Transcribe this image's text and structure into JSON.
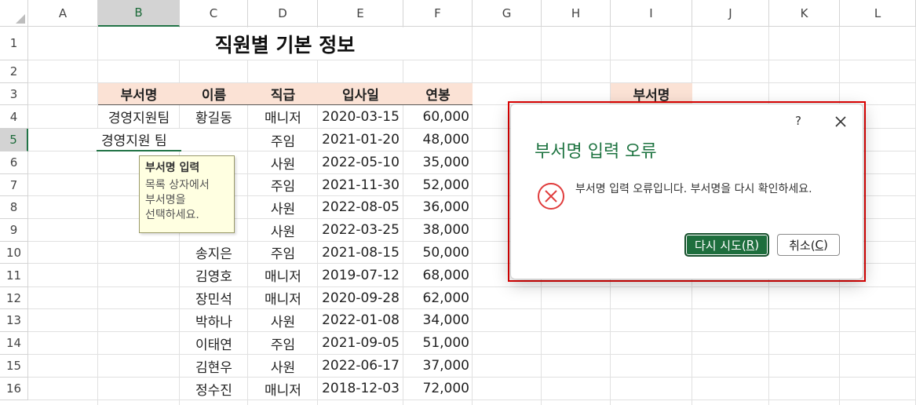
{
  "columns": [
    "A",
    "B",
    "C",
    "D",
    "E",
    "F",
    "G",
    "H",
    "I",
    "J",
    "K",
    "L"
  ],
  "selected_column": "B",
  "rows": [
    "1",
    "2",
    "3",
    "4",
    "5",
    "6",
    "7",
    "8",
    "9",
    "10",
    "11",
    "12",
    "13",
    "14",
    "15",
    "16"
  ],
  "selected_row": "5",
  "sheet_title": "직원별 기본 정보",
  "table_headers": [
    "부서명",
    "이름",
    "직급",
    "입사일",
    "연봉"
  ],
  "side_header": "부서명",
  "data_rows": [
    {
      "dept": "경영지원팀",
      "name": "황길동",
      "rank": "매니저",
      "date": "2020-03-15",
      "salary": "60,000"
    },
    {
      "dept": "",
      "name": "",
      "rank": "주임",
      "date": "2021-01-20",
      "salary": "48,000"
    },
    {
      "dept": "",
      "name": "",
      "rank": "사원",
      "date": "2022-05-10",
      "salary": "35,000"
    },
    {
      "dept": "",
      "name": "",
      "rank": "주임",
      "date": "2021-11-30",
      "salary": "52,000"
    },
    {
      "dept": "",
      "name": "",
      "rank": "사원",
      "date": "2022-08-05",
      "salary": "36,000"
    },
    {
      "dept": "",
      "name": "",
      "rank": "사원",
      "date": "2022-03-25",
      "salary": "38,000"
    },
    {
      "dept": "",
      "name": "송지은",
      "rank": "주임",
      "date": "2021-08-15",
      "salary": "50,000"
    },
    {
      "dept": "",
      "name": "김영호",
      "rank": "매니저",
      "date": "2019-07-12",
      "salary": "68,000"
    },
    {
      "dept": "",
      "name": "장민석",
      "rank": "매니저",
      "date": "2020-09-28",
      "salary": "62,000"
    },
    {
      "dept": "",
      "name": "박하나",
      "rank": "사원",
      "date": "2022-01-08",
      "salary": "34,000"
    },
    {
      "dept": "",
      "name": "이태연",
      "rank": "주임",
      "date": "2021-09-05",
      "salary": "51,000"
    },
    {
      "dept": "",
      "name": "김현우",
      "rank": "사원",
      "date": "2022-06-17",
      "salary": "37,000"
    },
    {
      "dept": "",
      "name": "정수진",
      "rank": "매니저",
      "date": "2018-12-03",
      "salary": "72,000"
    }
  ],
  "editing_cell_value": "경영지원 팀",
  "tooltip": {
    "title": "부서명 입력",
    "body": "목록 상자에서\n부서명을\n선택하세요."
  },
  "dialog": {
    "help": "?",
    "title": "부서명 입력 오류",
    "message": "부서명 입력 오류입니다. 부서명을 다시 확인하세요.",
    "retry_label": "다시 시도(",
    "retry_key": "R",
    "cancel_label": "취소(",
    "cancel_key": "C",
    "close_paren": ")",
    "icon": "error-circle-x-icon",
    "accent_color": "#1e6e3d",
    "error_color": "#e03c3c"
  }
}
